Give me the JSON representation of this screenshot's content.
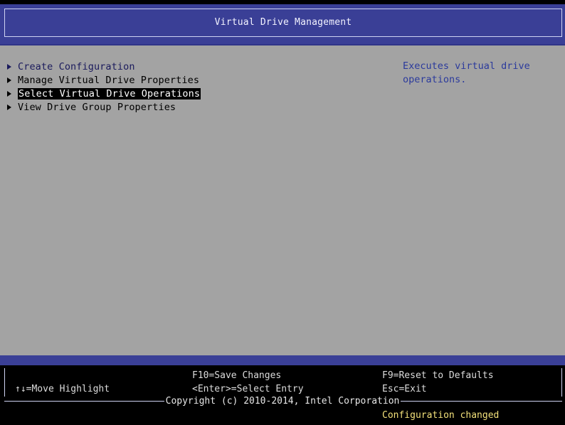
{
  "header": {
    "title": "Virtual Drive Management"
  },
  "menu": {
    "items": [
      {
        "label": "Create Configuration",
        "selected": false
      },
      {
        "label": "Manage Virtual Drive Properties",
        "selected": false
      },
      {
        "label": "Select Virtual Drive Operations",
        "selected": true
      },
      {
        "label": "View Drive Group Properties",
        "selected": false
      }
    ]
  },
  "help": {
    "text": "Executes virtual drive operations."
  },
  "footer": {
    "move_highlight": "↑↓=Move Highlight",
    "save_changes": "F10=Save Changes",
    "select_entry": "<Enter>=Select Entry",
    "reset_defaults": "F9=Reset to Defaults",
    "exit": "Esc=Exit",
    "copyright": "Copyright (c) 2010-2014, Intel Corporation",
    "status": "Configuration changed"
  },
  "colors": {
    "header_bg": "#3a3f96",
    "main_bg": "#a3a3a3",
    "menu_text": "#1a1a5c",
    "help_text": "#2b3a9c",
    "status_text": "#f2e07a"
  }
}
